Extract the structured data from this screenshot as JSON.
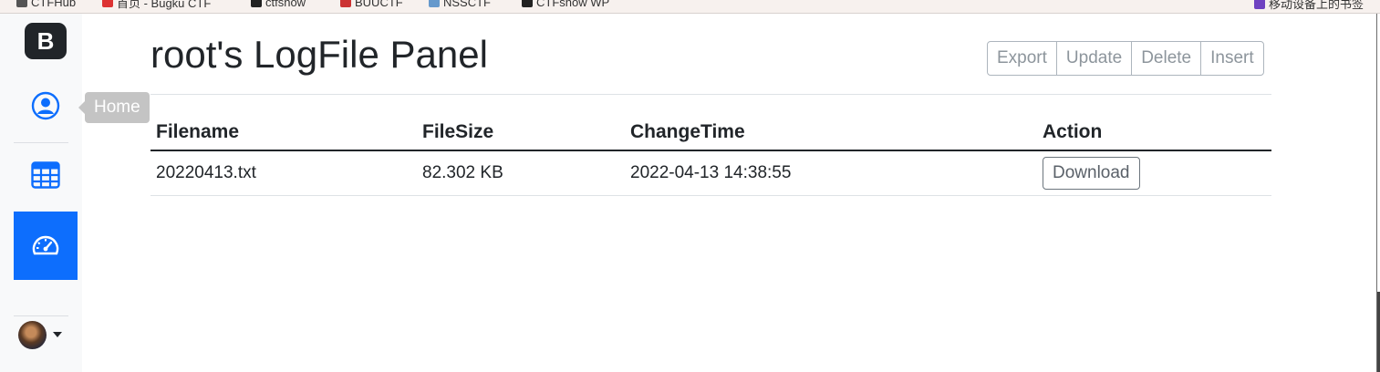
{
  "bookmarks": [
    {
      "label": "CTFHub"
    },
    {
      "label": "首页 - Bugku CTF"
    },
    {
      "label": "ctfshow"
    },
    {
      "label": "BUUCTF"
    },
    {
      "label": "NSSCTF"
    },
    {
      "label": "CTFshow WP"
    }
  ],
  "bookmarks_right": {
    "label": "移动设备上的书签"
  },
  "sidebar": {
    "brand_letter": "B",
    "items": [
      {
        "name": "home",
        "icon": "person-circle-icon",
        "tooltip": "Home"
      },
      {
        "name": "table",
        "icon": "grid-table-icon"
      },
      {
        "name": "dashboard",
        "icon": "speedometer-icon",
        "active": true
      }
    ],
    "user": {
      "icon": "avatar"
    }
  },
  "header": {
    "title": "root's LogFile Panel",
    "actions": [
      "Export",
      "Update",
      "Delete",
      "Insert"
    ]
  },
  "table": {
    "columns": [
      "Filename",
      "FileSize",
      "ChangeTime",
      "Action"
    ],
    "rows": [
      {
        "filename": "20220413.txt",
        "filesize": "82.302 KB",
        "changetime": "2022-04-13 14:38:55",
        "action": "Download"
      }
    ]
  },
  "colors": {
    "accent": "#0d6efd",
    "text": "#212529",
    "muted_button": "#8d959c"
  }
}
